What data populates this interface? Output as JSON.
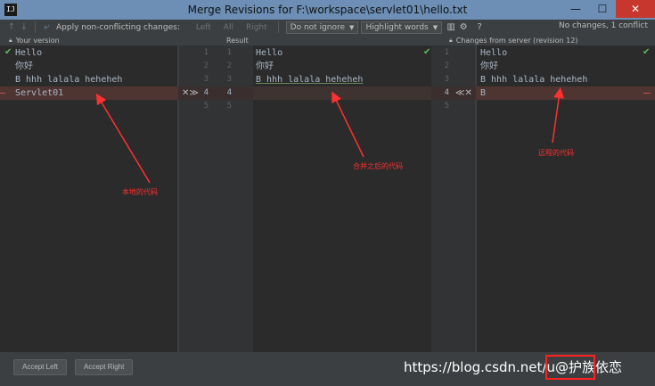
{
  "window": {
    "title": "Merge Revisions for F:\\workspace\\servlet01\\hello.txt",
    "app_icon_label": "IJ",
    "minimize": "—",
    "maximize": "☐",
    "close": "✕"
  },
  "toolbar": {
    "prev_icon": "↑",
    "next_icon": "↓",
    "apply_icon": "⤶",
    "apply_label": "Apply non-conflicting changes:",
    "left_label": "Left",
    "all_label": "All",
    "right_label": "Right",
    "whitespace_select": "Do not ignore",
    "highlight_select": "Highlight words",
    "columns_icon": "▥",
    "settings_icon": "⚙",
    "help_icon": "?",
    "status": "No changes, 1 conflict"
  },
  "headers": {
    "left": "Your version",
    "center": "Result",
    "right": "Changes from server (revision 12)"
  },
  "left_pane": {
    "lines": [
      "Hello",
      "你好",
      "B hhh lalala heheheh",
      "Servlet01"
    ]
  },
  "center_pane": {
    "lines": [
      "Hello",
      "你好",
      "B hhh lalala heheheh"
    ],
    "left_numbers": [
      "1",
      "2",
      "3",
      "4",
      "5"
    ],
    "right_numbers": [
      "1",
      "2",
      "3",
      "4",
      "5"
    ]
  },
  "right_pane": {
    "lines": [
      "Hello",
      "你好",
      "B hhh lalala heheheh",
      "B"
    ],
    "numbers": [
      "1",
      "2",
      "3",
      "4",
      "5"
    ]
  },
  "markers": {
    "left_conflict": "✕≫",
    "right_conflict": "≪✕",
    "check": "✔"
  },
  "annotations": {
    "local": "本地的代码",
    "merged": "合并之后的代码",
    "remote": "远程的代码"
  },
  "buttons": {
    "accept_left": "Accept Left",
    "accept_right": "Accept Right"
  },
  "watermark": "https://blog.csdn.net/u@护族依恋",
  "colors": {
    "conflict_bg": "#4e3532",
    "annotation": "#ff3030",
    "title_bar": "#6d8fb5"
  }
}
